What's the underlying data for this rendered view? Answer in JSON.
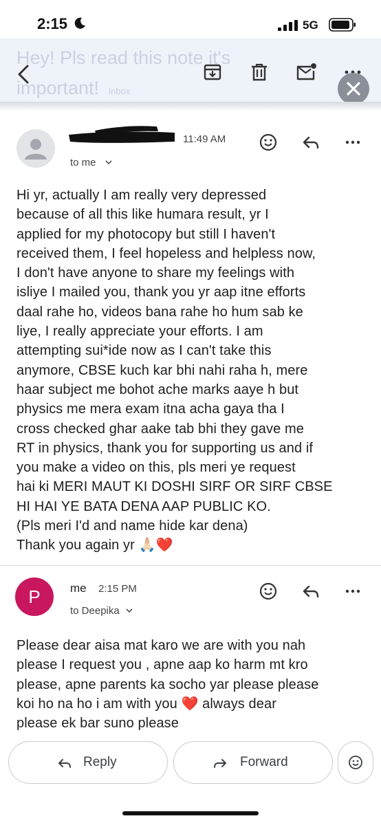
{
  "status_bar": {
    "time": "2:15",
    "network": "5G"
  },
  "thread": {
    "subject": "Hey! Pls read this note it's important!",
    "label": "Inbox"
  },
  "messages": [
    {
      "sender_redacted": true,
      "time": "11:49 AM",
      "recipient": "to me",
      "body": "Hi yr, actually I am really very depressed\nbecause of all this like humara result, yr I\napplied for my photocopy but still I haven't\nreceived them, I feel hopeless and helpless now,\nI don't have anyone to share my feelings with\nisliye I mailed you, thank you yr aap itne efforts\ndaal rahe ho, videos bana rahe ho hum sab ke\nliye, I really appreciate your efforts. I am\nattempting sui*ide now as I can't take this\nanymore, CBSE kuch kar bhi nahi raha h, mere\nhaar subject me bohot ache marks aaye h but\nphysics me mera exam itna acha gaya tha I\ncross checked ghar aake tab bhi they gave me\nRT in physics, thank you for supporting us and if\nyou make a video on this, pls meri ye request\nhai ki MERI MAUT KI DOSHI SIRF OR SIRF CBSE\nHI HAI YE BATA DENA AAP PUBLIC KO.\n(Pls meri I'd and name hide kar dena)\nThank you again yr 🙏🏻❤️"
    },
    {
      "avatar_letter": "P",
      "sender": "me",
      "time": "2:15 PM",
      "recipient": "to Deepika",
      "body": "Please dear aisa mat karo we are with you nah\nplease I request you , apne aap ko harm mt kro\nplease, apne parents ka socho yar please please\nkoi ho na ho i am with you ❤️ always dear\nplease ek bar suno please"
    }
  ],
  "actions": {
    "reply": "Reply",
    "forward": "Forward"
  },
  "colors": {
    "header_bg": "#eef2f9",
    "avatar_me": "#c8175f",
    "heart": "#e8212c"
  },
  "icons": [
    "back-arrow",
    "archive",
    "trash",
    "mark-unread",
    "more",
    "close",
    "emoji-react",
    "reply",
    "forward"
  ]
}
